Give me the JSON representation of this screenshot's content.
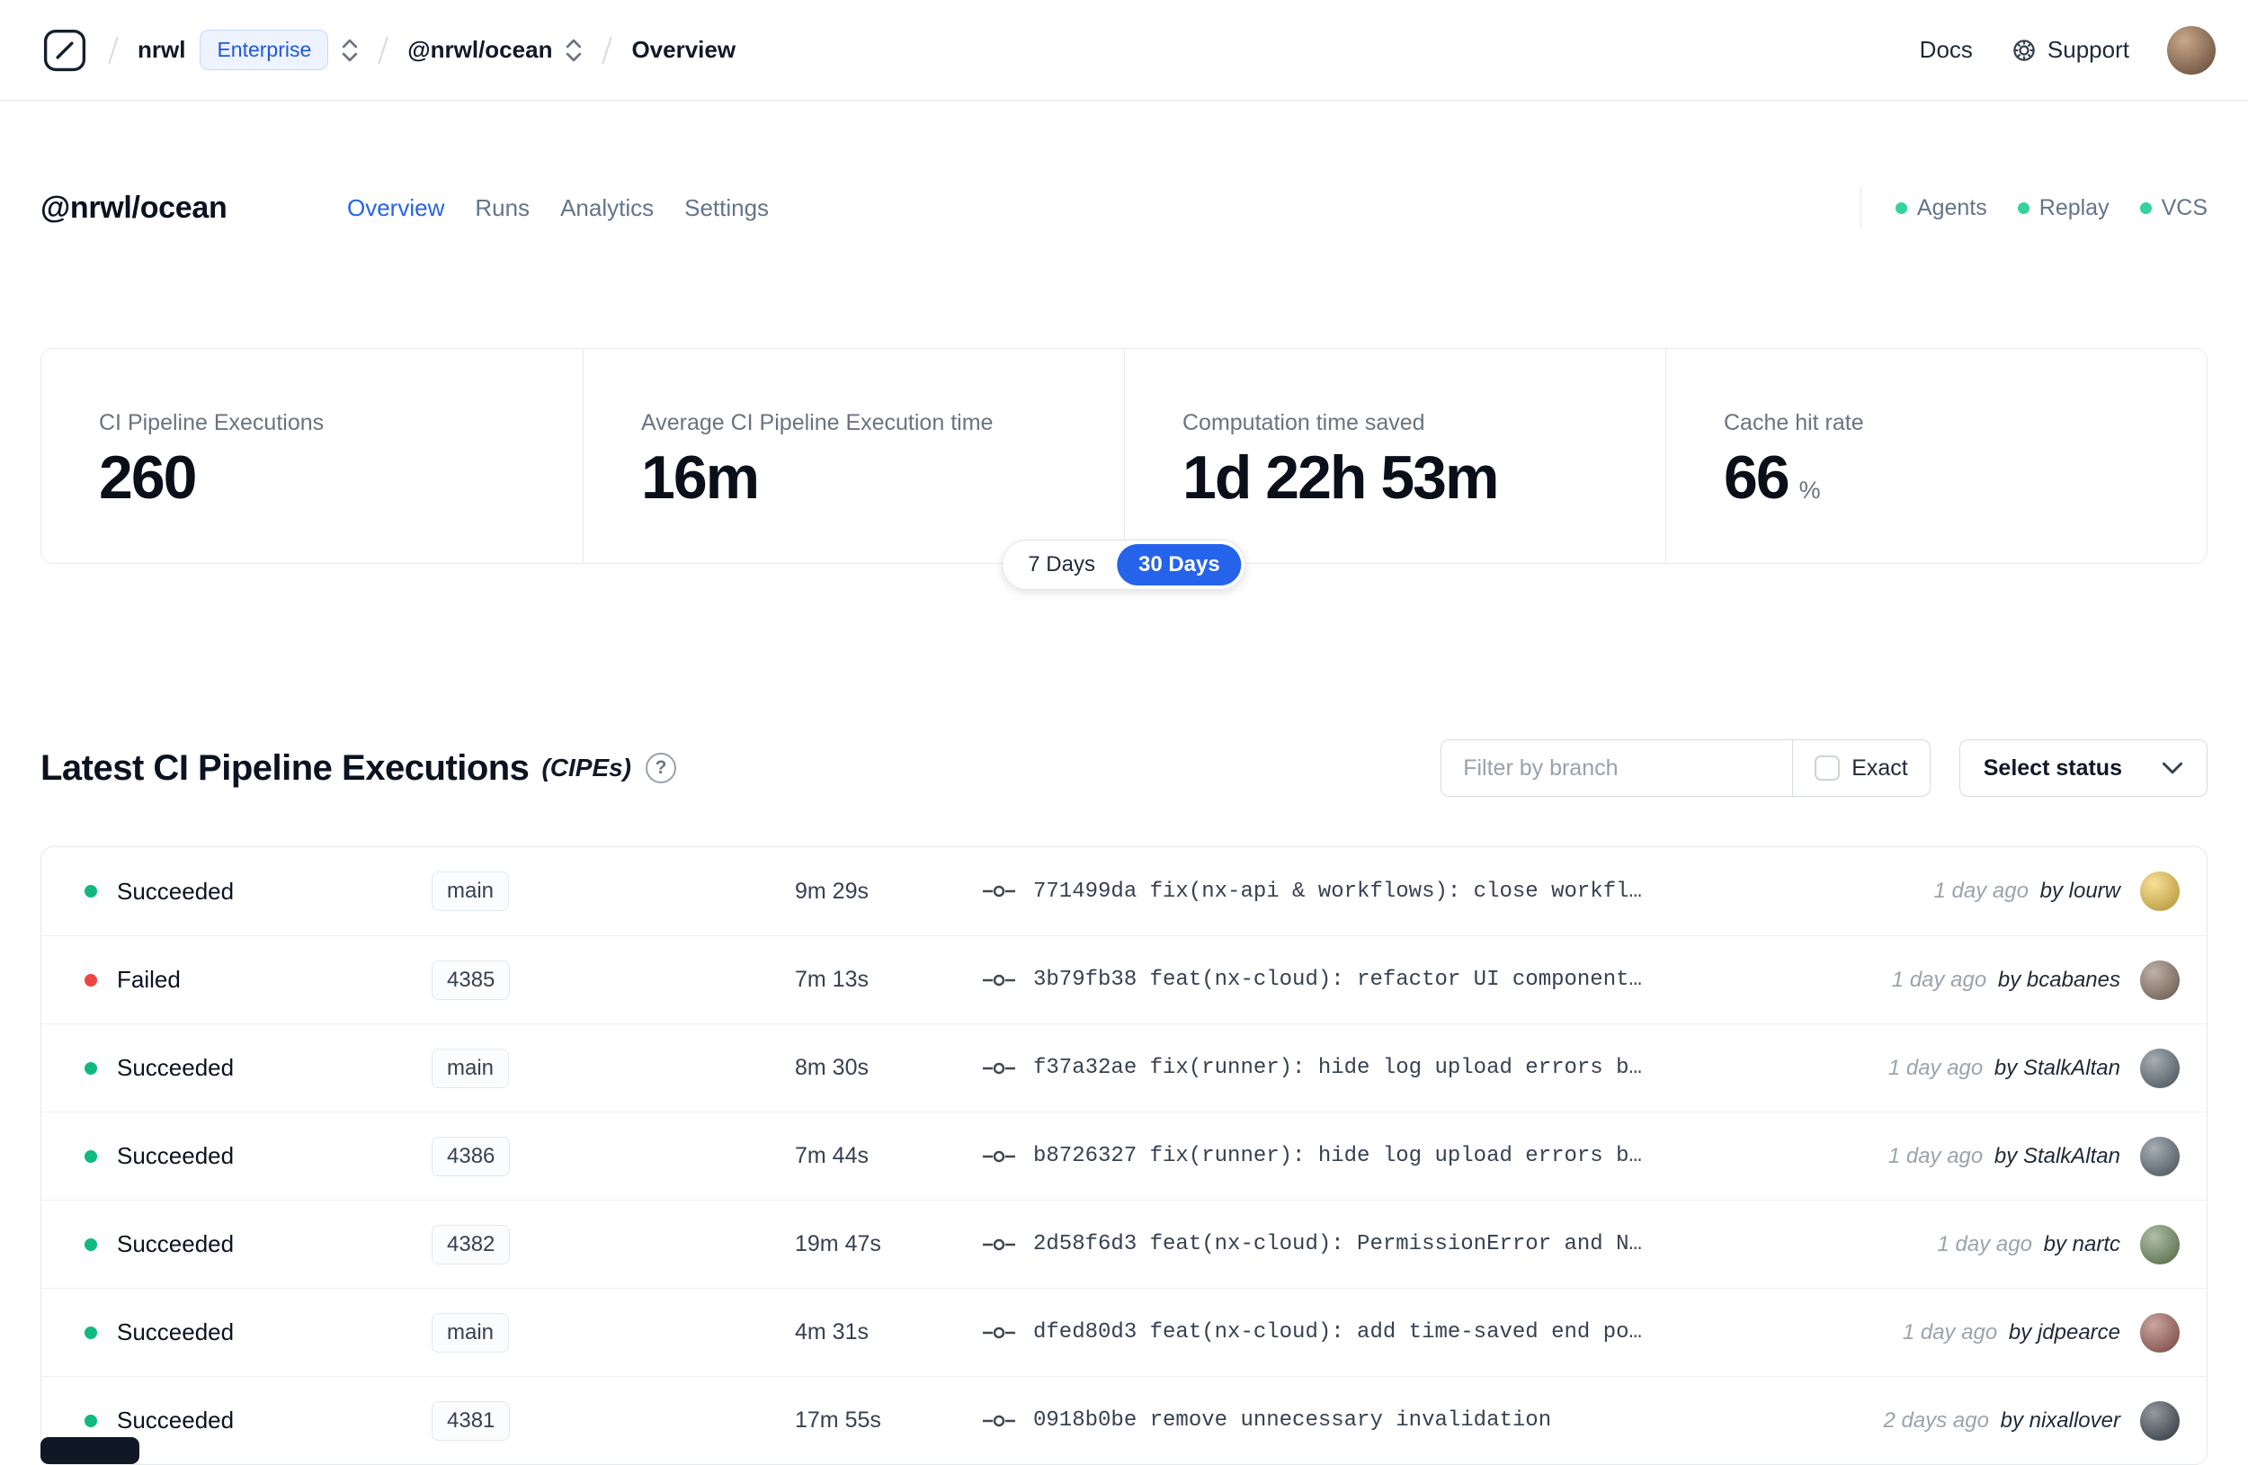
{
  "navbar": {
    "org": "nrwl",
    "plan_badge": "Enterprise",
    "workspace": "@nrwl/ocean",
    "page": "Overview",
    "docs_label": "Docs",
    "support_label": "Support"
  },
  "header": {
    "workspace_title": "@nrwl/ocean",
    "tabs": [
      {
        "label": "Overview",
        "active": true
      },
      {
        "label": "Runs",
        "active": false
      },
      {
        "label": "Analytics",
        "active": false
      },
      {
        "label": "Settings",
        "active": false
      }
    ],
    "status_indicators": [
      {
        "label": "Agents",
        "color": "#34d399"
      },
      {
        "label": "Replay",
        "color": "#34d399"
      },
      {
        "label": "VCS",
        "color": "#34d399"
      }
    ],
    "active_tab_color": "#2563eb"
  },
  "stats": {
    "cards": [
      {
        "title": "CI Pipeline Executions",
        "value": "260"
      },
      {
        "title": "Average CI Pipeline Execution time",
        "value": "16m"
      },
      {
        "title": "Computation time saved",
        "value": "1d 22h 53m"
      },
      {
        "title": "Cache hit rate",
        "value": "66",
        "suffix": "%"
      }
    ],
    "range_toggle": {
      "options": [
        "7 Days",
        "30 Days"
      ],
      "selected": "30 Days",
      "active_color": "#2563eb"
    }
  },
  "cipe_section": {
    "title": "Latest CI Pipeline Executions",
    "subtitle": "(CIPEs)",
    "help_glyph": "?",
    "filter_placeholder": "Filter by branch",
    "exact_label": "Exact",
    "exact_checked": false,
    "status_dropdown_label": "Select status"
  },
  "table": {
    "rows": [
      {
        "status": "Succeeded",
        "status_color": "#10b981",
        "branch": "main",
        "duration": "9m 29s",
        "commit": "771499da fix(nx-api & workflows): close workfl…",
        "time_ago": "1 day ago",
        "author": "by lourw",
        "avatar_color": "#f2c744"
      },
      {
        "status": "Failed",
        "status_color": "#ef4444",
        "branch": "4385",
        "duration": "7m 13s",
        "commit": "3b79fb38 feat(nx-cloud): refactor UI component…",
        "time_ago": "1 day ago",
        "author": "by bcabanes",
        "avatar_color": "#8a7261"
      },
      {
        "status": "Succeeded",
        "status_color": "#10b981",
        "branch": "main",
        "duration": "8m 30s",
        "commit": "f37a32ae fix(runner): hide log upload errors b…",
        "time_ago": "1 day ago",
        "author": "by StalkAltan",
        "avatar_color": "#5d6b76"
      },
      {
        "status": "Succeeded",
        "status_color": "#10b981",
        "branch": "4386",
        "duration": "7m 44s",
        "commit": "b8726327 fix(runner): hide log upload errors b…",
        "time_ago": "1 day ago",
        "author": "by StalkAltan",
        "avatar_color": "#5d6b76"
      },
      {
        "status": "Succeeded",
        "status_color": "#10b981",
        "branch": "4382",
        "duration": "19m 47s",
        "commit": "2d58f6d3 feat(nx-cloud): PermissionError and N…",
        "time_ago": "1 day ago",
        "author": "by nartc",
        "avatar_color": "#6d8a5b"
      },
      {
        "status": "Succeeded",
        "status_color": "#10b981",
        "branch": "main",
        "duration": "4m 31s",
        "commit": "dfed80d3 feat(nx-cloud): add time-saved end po…",
        "time_ago": "1 day ago",
        "author": "by jdpearce",
        "avatar_color": "#a05c52"
      },
      {
        "status": "Succeeded",
        "status_color": "#10b981",
        "branch": "4381",
        "duration": "17m 55s",
        "commit": "0918b0be remove unnecessary invalidation",
        "time_ago": "2 days ago",
        "author": "by nixallover",
        "avatar_color": "#3d4652"
      }
    ]
  }
}
